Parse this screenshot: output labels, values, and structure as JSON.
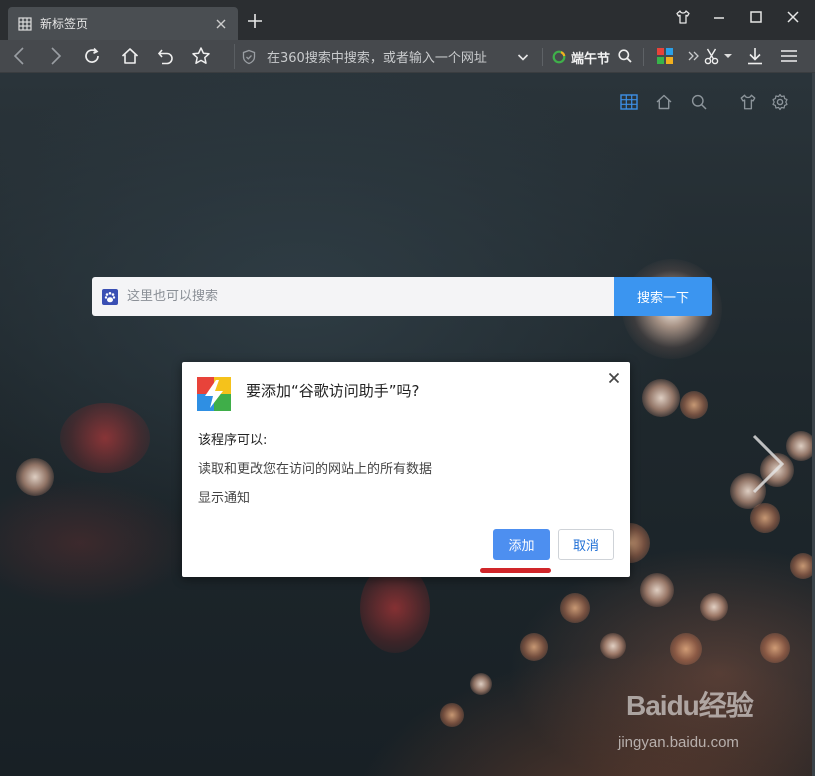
{
  "browser": {
    "tab": {
      "title": "新标签页"
    },
    "address_bar": {
      "placeholder": "在360搜索中搜索，或者输入一个网址"
    },
    "news_label": "端午节",
    "icons": {
      "tab": "grid-icon",
      "tab_close": "close-icon",
      "new_tab": "plus-icon",
      "skin": "shirt-icon",
      "minimize": "minimize-icon",
      "maximize": "maximize-icon",
      "close": "close-icon",
      "back": "back-icon",
      "forward": "forward-icon",
      "refresh": "refresh-icon",
      "home": "home-icon",
      "undo": "undo-icon",
      "favorite": "star-icon",
      "shield": "shield-icon",
      "dropdown": "chevron-down-icon",
      "search": "search-icon",
      "apps": "apps-icon",
      "more": "double-chevron-icon",
      "cut": "scissors-icon",
      "download": "download-icon",
      "menu": "menu-icon"
    }
  },
  "newtab": {
    "icons": [
      "grid-icon",
      "home-icon",
      "search-icon",
      "shirt-icon",
      "gear-icon"
    ],
    "search": {
      "placeholder": "这里也可以搜索",
      "button": "搜索一下"
    }
  },
  "dialog": {
    "title": "要添加“谷歌访问助手”吗?",
    "subtitle": "该程序可以:",
    "permissions": [
      "读取和更改您在访问的网站上的所有数据",
      "显示通知"
    ],
    "add_button": "添加",
    "cancel_button": "取消"
  },
  "watermark": {
    "brand": "Baidu经验",
    "site": "jingyan.baidu.com"
  },
  "colors": {
    "accent_blue": "#3b95f0",
    "add_button": "#4d8ff0",
    "highlight_red": "#d0262a",
    "titlebar": "#2b2e31",
    "toolbar": "#46494d"
  }
}
